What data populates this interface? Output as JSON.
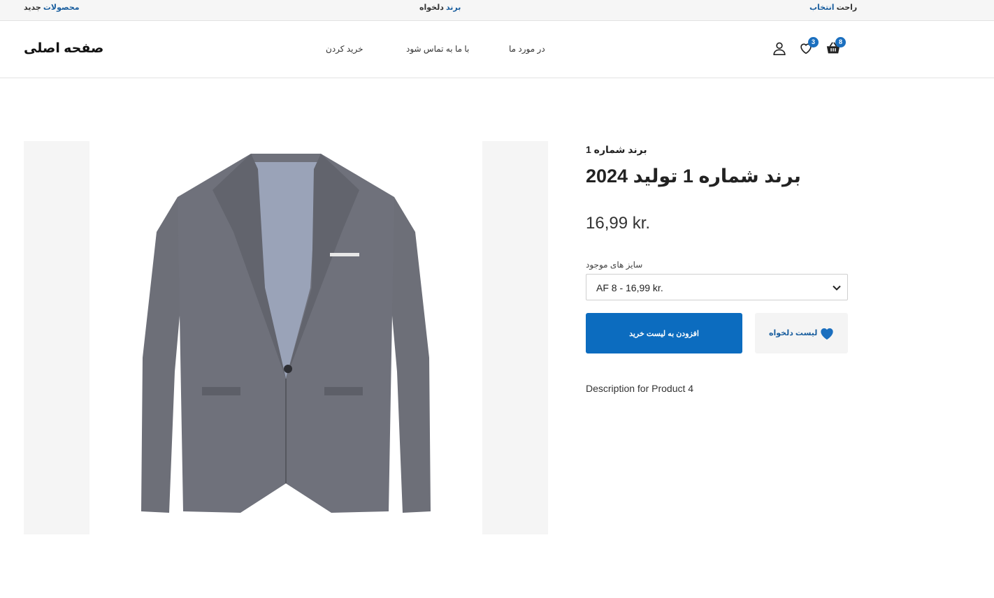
{
  "topbar": {
    "left_accent": "محصولات",
    "left_plain": "جدید",
    "center_accent": "برند",
    "center_plain": "دلخواه",
    "right_accent": "انتخاب",
    "right_plain": "راحت"
  },
  "header": {
    "logo": "صفحه اصلی",
    "nav": [
      "خرید کردن",
      "با ما به تماس شود",
      "در مورد ما"
    ],
    "wishlist_count": "3",
    "cart_count": "8"
  },
  "product": {
    "brand": "برند شماره 1",
    "title": "برند شماره 1 تولید 2024",
    "price": "16,99 kr.",
    "size_label": "سایز های موجود",
    "size_selected": "AF 8 - 16,99 kr.",
    "add_to_cart": "افزودن به لیست خرید",
    "wishlist": "لیست دلخواه",
    "description": "Description for Product 4"
  },
  "colors": {
    "accent": "#0c6cbf",
    "badge": "#1b6fbf"
  },
  "icons": [
    "user-icon",
    "heart-icon",
    "basket-icon",
    "chevron-down-icon"
  ]
}
